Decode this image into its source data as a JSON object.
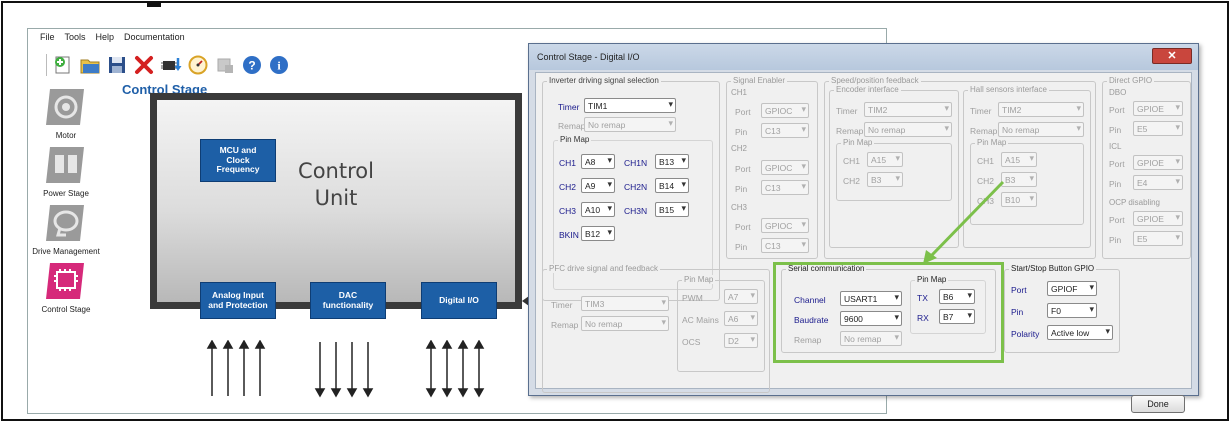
{
  "menubar": [
    "File",
    "Tools",
    "Help",
    "Documentation"
  ],
  "toolbar": {
    "icons": [
      "new-project-icon",
      "open-folder-icon",
      "save-icon",
      "delete-icon",
      "chip-download-icon",
      "gauge-icon",
      "disabled-tool-icon",
      "help-icon",
      "info-icon"
    ]
  },
  "app_title": "Control Stage",
  "sidebar": {
    "items": [
      {
        "label": "Motor"
      },
      {
        "label": "Power Stage"
      },
      {
        "label": "Drive Management"
      },
      {
        "label": "Control Stage"
      }
    ]
  },
  "diagram": {
    "title": "Control\nUnit",
    "blocks": {
      "mcu": "MCU and\nClock\nFrequency",
      "analog": "Analog Input\nand Protection",
      "dac": "DAC\nfunctionality",
      "dio": "Digital I/O"
    }
  },
  "dialog": {
    "title": "Control Stage - Digital I/O",
    "close": "✕",
    "done": "Done",
    "inverter": {
      "title": "Inverter driving signal selection",
      "timer_label": "Timer",
      "timer": "TIM1",
      "remap_label": "Remap",
      "remap": "No remap",
      "pinmap_title": "Pin Map",
      "ch1_label": "CH1",
      "ch1": "A8",
      "ch1n_label": "CH1N",
      "ch1n": "B13",
      "ch2_label": "CH2",
      "ch2": "A9",
      "ch2n_label": "CH2N",
      "ch2n": "B14",
      "ch3_label": "CH3",
      "ch3": "A10",
      "ch3n_label": "CH3N",
      "ch3n": "B15",
      "bkin_label": "BKIN",
      "bkin": "B12"
    },
    "signal_enabler": {
      "title": "Signal Enabler",
      "ch1": "CH1",
      "ch2": "CH2",
      "ch3": "CH3",
      "port_label": "Port",
      "pin_label": "Pin",
      "ch1_port": "GPIOC",
      "ch1_pin": "C13",
      "ch2_port": "GPIOC",
      "ch2_pin": "C13",
      "ch3_port": "GPIOC",
      "ch3_pin": "C13"
    },
    "speed": {
      "title": "Speed/position feedback",
      "encoder_title": "Encoder interface",
      "timer_label": "Timer",
      "timer": "TIM2",
      "remap_label": "Remap",
      "remap": "No remap",
      "pinmap_title": "Pin Map",
      "ch1_label": "CH1",
      "ch1": "A15",
      "ch2_label": "CH2",
      "ch2": "B3"
    },
    "hall": {
      "title": "Hall sensors interface",
      "timer_label": "Timer",
      "timer": "TIM2",
      "remap_label": "Remap",
      "remap": "No remap",
      "pinmap_title": "Pin Map",
      "ch1_label": "CH1",
      "ch1": "A15",
      "ch2_label": "CH2",
      "ch2": "B3",
      "ch3_label": "CH3",
      "ch3": "B10"
    },
    "direct_gpio": {
      "title": "Direct GPIO",
      "dbo_title": "DBO",
      "icl_title": "ICL",
      "ocp_title": "OCP disabling",
      "port_label": "Port",
      "pin_label": "Pin",
      "dbo_port": "GPIOE",
      "dbo_pin": "E5",
      "icl_port": "GPIOE",
      "icl_pin": "E4",
      "ocp_port": "GPIOE",
      "ocp_pin": "E5"
    },
    "pfc": {
      "title": "PFC drive signal and feedback",
      "timer_label": "Timer",
      "timer": "TIM3",
      "remap_label": "Remap",
      "remap": "No remap",
      "pinmap_title": "Pin Map",
      "pwm_label": "PWM",
      "pwm": "A7",
      "acmains_label": "AC Mains",
      "acmains": "A6",
      "ocs_label": "OCS",
      "ocs": "D2"
    },
    "serial": {
      "title": "Serial communication",
      "channel_label": "Channel",
      "channel": "USART1",
      "baudrate_label": "Baudrate",
      "baudrate": "9600",
      "remap_label": "Remap",
      "remap": "No remap",
      "pinmap_title": "Pin Map",
      "tx_label": "TX",
      "tx": "B6",
      "rx_label": "RX",
      "rx": "B7"
    },
    "startstop": {
      "title": "Start/Stop Button GPIO",
      "port_label": "Port",
      "port": "GPIOF",
      "pin_label": "Pin",
      "pin": "F0",
      "polarity_label": "Polarity",
      "polarity": "Active low"
    }
  },
  "colors": {
    "accent_blue": "#1d5fa6",
    "label_blue": "#1a1a8c",
    "highlight_green": "#7cc04a",
    "close_red": "#c9463d"
  }
}
